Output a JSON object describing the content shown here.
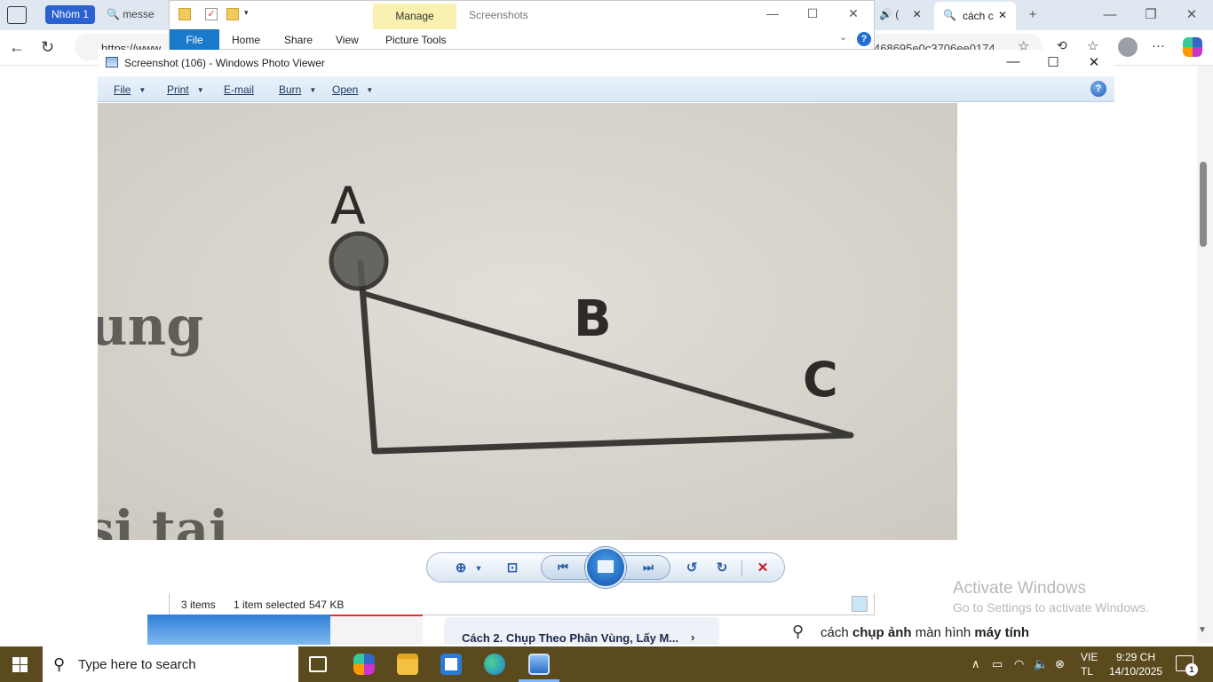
{
  "browser": {
    "tab_group": "Nhóm 1",
    "tab_messenger": "messe",
    "tab_speaker_label": "(",
    "tab_active": "cách c",
    "url_left": "https://www.",
    "url_right": "468695e0c3706ee0174"
  },
  "explorer": {
    "title": "Screenshots",
    "manage_tab": "Manage",
    "ribbon_tabs": [
      "File",
      "Home",
      "Share",
      "View",
      "Picture Tools"
    ],
    "status_items": "3 items",
    "status_selected": "1 item selected",
    "status_size": "547 KB"
  },
  "photo_viewer": {
    "title": "Screenshot (106) - Windows Photo Viewer",
    "menu": [
      "File",
      "Print",
      "E-mail",
      "Burn",
      "Open"
    ],
    "photo_labels": {
      "a": "A",
      "b": "B",
      "c": "C",
      "left_text_top": "ung",
      "left_text_bottom": "si tai"
    },
    "controls": [
      "zoom-icon",
      "fit-window-icon",
      "previous-icon",
      "slideshow-icon",
      "next-icon",
      "rotate-counterclockwise-icon",
      "rotate-clockwise-icon",
      "delete-icon"
    ]
  },
  "page": {
    "article_title": "Cách 2. Chụp Theo Phân Vùng, Lấy M...",
    "search_suggestion_parts": [
      "cách ",
      "chụp ảnh",
      " màn hình ",
      "máy tính"
    ]
  },
  "watermark": {
    "line1": "Activate Windows",
    "line2": "Go to Settings to activate Windows."
  },
  "taskbar": {
    "search_placeholder": "Type here to search",
    "lang_line1": "VIE",
    "lang_line2": "TL",
    "time": "9:29 CH",
    "date": "14/10/2025",
    "notification_count": "1"
  },
  "colors": {
    "accent_blue": "#1979ca",
    "manage_yellow": "#f9f1b0",
    "taskbar": "#5a4a1e",
    "photo_paper": "#d9d6cf"
  }
}
